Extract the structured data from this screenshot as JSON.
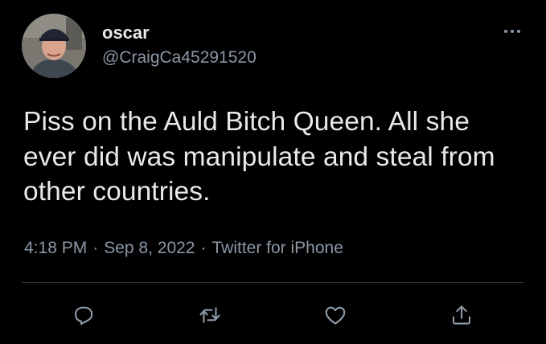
{
  "tweet": {
    "display_name": "oscar",
    "handle": "@CraigCa45291520",
    "text": "Piss on the Auld Bitch Queen. All she ever did was manipulate and steal from other countries.",
    "time": "4:18 PM",
    "date": "Sep 8, 2022",
    "separator": "·",
    "source": "Twitter for iPhone"
  },
  "icons": {
    "more": "more-horizontal-icon",
    "reply": "reply-icon",
    "retweet": "retweet-icon",
    "like": "heart-icon",
    "share": "share-icon"
  },
  "colors": {
    "background": "#000000",
    "primary_text": "#e7e9ea",
    "secondary_text": "#8b98a5",
    "divider": "#2f3336"
  }
}
